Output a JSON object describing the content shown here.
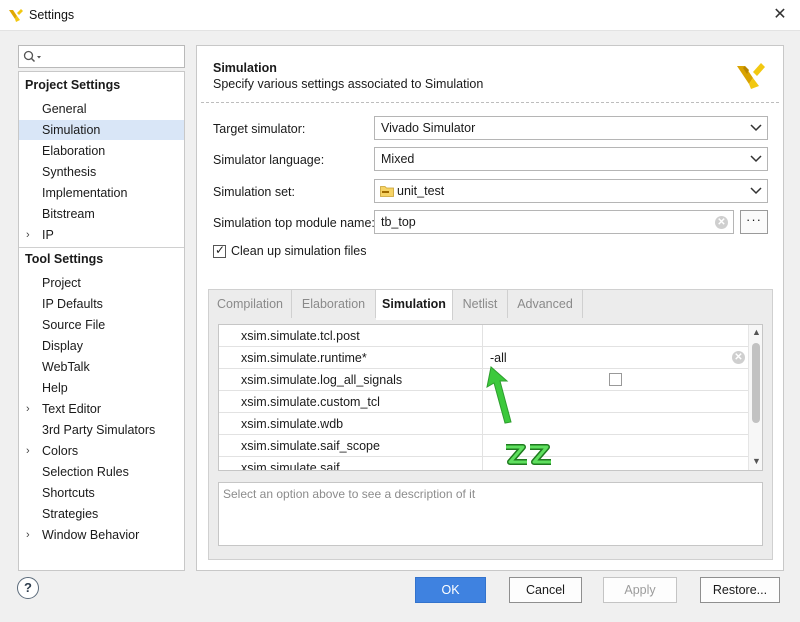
{
  "window": {
    "title": "Settings",
    "close_glyph": "✕",
    "icon": "vivado-logo-icon",
    "brand_color": "#f2c811"
  },
  "sidebar": {
    "search_placeholder": "",
    "search_icon": "search-icon",
    "project_settings_header": "Project Settings",
    "project_items": [
      {
        "label": "General",
        "expandable": false
      },
      {
        "label": "Simulation",
        "expandable": false,
        "selected": true
      },
      {
        "label": "Elaboration",
        "expandable": false
      },
      {
        "label": "Synthesis",
        "expandable": false
      },
      {
        "label": "Implementation",
        "expandable": false
      },
      {
        "label": "Bitstream",
        "expandable": false
      },
      {
        "label": "IP",
        "expandable": true
      }
    ],
    "tool_settings_header": "Tool Settings",
    "tool_items": [
      {
        "label": "Project",
        "expandable": false
      },
      {
        "label": "IP Defaults",
        "expandable": false
      },
      {
        "label": "Source File",
        "expandable": false
      },
      {
        "label": "Display",
        "expandable": false
      },
      {
        "label": "WebTalk",
        "expandable": false
      },
      {
        "label": "Help",
        "expandable": false
      },
      {
        "label": "Text Editor",
        "expandable": true
      },
      {
        "label": "3rd Party Simulators",
        "expandable": false
      },
      {
        "label": "Colors",
        "expandable": true
      },
      {
        "label": "Selection Rules",
        "expandable": false
      },
      {
        "label": "Shortcuts",
        "expandable": false
      },
      {
        "label": "Strategies",
        "expandable": false
      },
      {
        "label": "Window Behavior",
        "expandable": true
      }
    ],
    "expand_glyph": "›",
    "selected_color": "#d9e6f7"
  },
  "help_button": {
    "label": "?"
  },
  "section": {
    "title": "Simulation",
    "description": "Specify various settings associated to Simulation"
  },
  "form": {
    "target_simulator_label": "Target simulator:",
    "target_simulator_value": "Vivado Simulator",
    "simulator_language_label": "Simulator language:",
    "simulator_language_value": "Mixed",
    "simulation_set_label": "Simulation set:",
    "simulation_set_value": "unit_test",
    "top_module_label": "Simulation top module name:",
    "top_module_value": "tb_top",
    "browse_label": "···",
    "cleanup_label": "Clean up simulation files",
    "cleanup_checked": true,
    "check_glyph": "✓"
  },
  "tabs": [
    {
      "label": "Compilation",
      "active": false
    },
    {
      "label": "Elaboration",
      "active": false
    },
    {
      "label": "Simulation",
      "active": true
    },
    {
      "label": "Netlist",
      "active": false
    },
    {
      "label": "Advanced",
      "active": false
    }
  ],
  "properties": [
    {
      "key": "xsim.simulate.tcl.post",
      "value": ""
    },
    {
      "key": "xsim.simulate.runtime*",
      "value": "-all"
    },
    {
      "key": "xsim.simulate.log_all_signals",
      "value": "",
      "checkbox": true,
      "checked": false
    },
    {
      "key": "xsim.simulate.custom_tcl",
      "value": ""
    },
    {
      "key": "xsim.simulate.wdb",
      "value": ""
    },
    {
      "key": "xsim.simulate.saif_scope",
      "value": ""
    },
    {
      "key": "xsim.simulate.saif",
      "value": ""
    }
  ],
  "description_placeholder": "Select an option above to see a description of it",
  "annotation": {
    "arrow_color": "#3cc93c",
    "icon": "green-arrow-icon"
  },
  "buttons": {
    "ok": "OK",
    "cancel": "Cancel",
    "apply": "Apply",
    "restore": "Restore...",
    "ok_color": "#3f82e0"
  }
}
